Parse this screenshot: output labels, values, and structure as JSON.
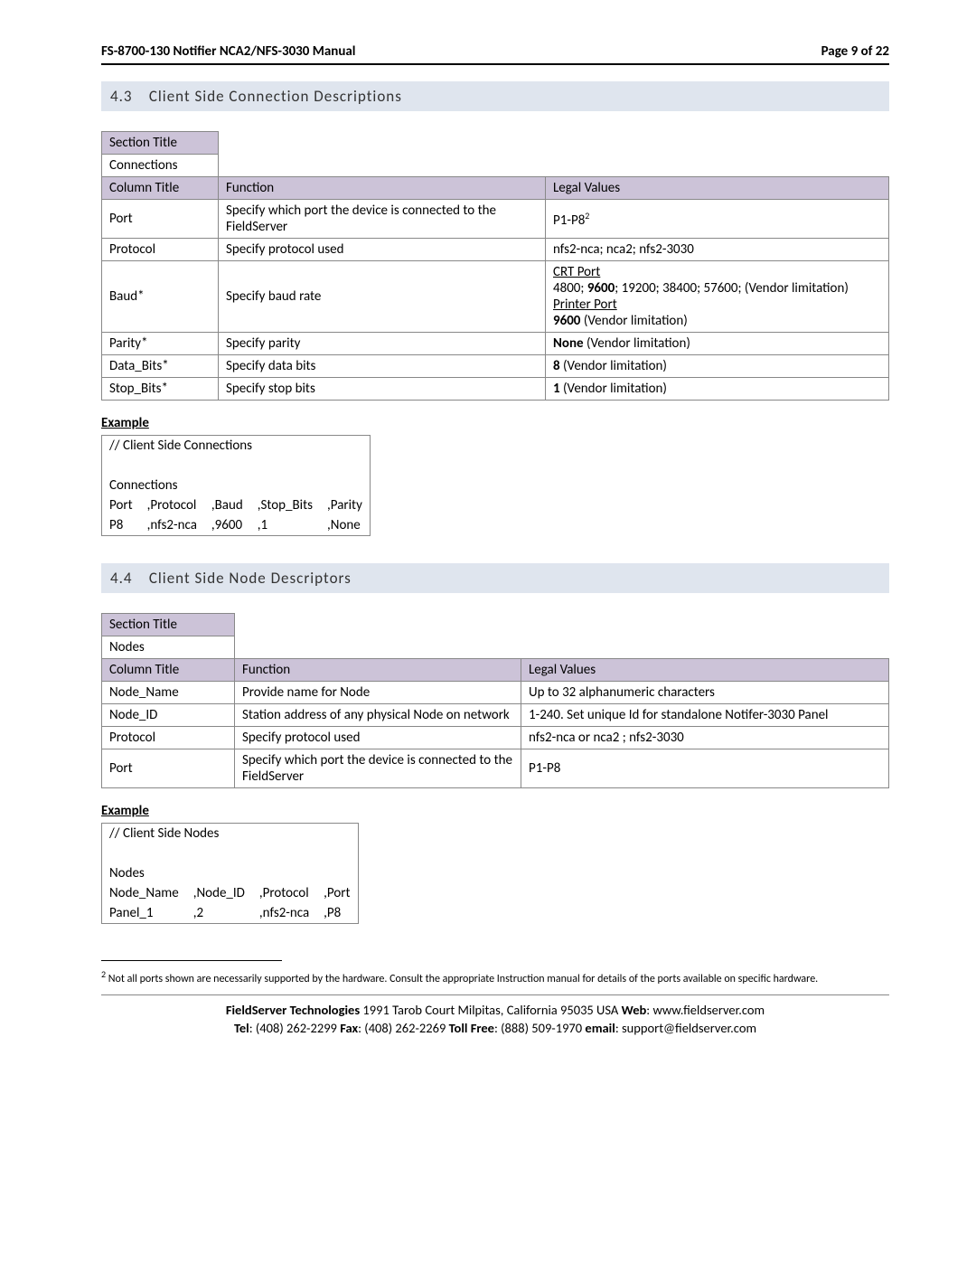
{
  "header": {
    "title": "FS-8700-130 Notifier NCA2/NFS-3030 Manual",
    "page": "Page 9 of 22"
  },
  "section43": {
    "num": "4.3",
    "title": "Client Side Connection Descriptions",
    "t_section_title": "Section Title",
    "t_connections": "Connections",
    "t_column_title": "Column Title",
    "t_function": "Function",
    "t_legal": "Legal Values",
    "rows": {
      "port": {
        "label": "Port",
        "func": "Specify which port the device is connected to the FieldServer",
        "legal_pre": "P1-P8",
        "legal_sup": "2"
      },
      "protocol": {
        "label": "Protocol",
        "func": "Specify protocol used",
        "legal": "nfs2-nca; nca2; nfs2-3030"
      },
      "baud": {
        "label": "Baud*",
        "func": "Specify baud rate",
        "crt": "CRT Port",
        "crt_vals_pre": "4800; ",
        "crt_vals_bold": "9600",
        "crt_vals_post": "; 19200; 38400; 57600; (Vendor limitation)",
        "prn": "Printer Port",
        "prn_bold": "9600",
        "prn_post": " (Vendor limitation)"
      },
      "parity": {
        "label": "Parity*",
        "func": "Specify parity",
        "legal_bold": "None",
        "legal_post": " (Vendor limitation)"
      },
      "databits": {
        "label": "Data_Bits*",
        "func": "Specify data bits",
        "legal_bold": "8",
        "legal_post": " (Vendor limitation)"
      },
      "stopbits": {
        "label": "Stop_Bits*",
        "func": "Specify stop bits",
        "legal_bold": "1",
        "legal_post": " (Vendor limitation)"
      }
    },
    "example_label": "Example",
    "code": {
      "l1": "//    Client Side Connections",
      "l2": "Connections",
      "h": {
        "c1": "Port",
        "c2": ",Protocol",
        "c3": ",Baud",
        "c4": ",Stop_Bits",
        "c5": ",Parity"
      },
      "d": {
        "c1": "P8",
        "c2": ",nfs2-nca",
        "c3": ",9600",
        "c4": ",1",
        "c5": ",None"
      }
    }
  },
  "section44": {
    "num": "4.4",
    "title": "Client Side Node Descriptors",
    "t_section_title": "Section Title",
    "t_nodes": "Nodes",
    "t_column_title": "Column Title",
    "t_function": "Function",
    "t_legal": "Legal Values",
    "rows": {
      "node_name": {
        "label": "Node_Name",
        "func": "Provide name for Node",
        "legal": "Up to 32 alphanumeric characters"
      },
      "node_id": {
        "label": "Node_ID",
        "func": "Station address of any physical Node on network",
        "legal": "1-240.  Set unique Id for standalone Notifer-3030 Panel"
      },
      "protocol": {
        "label": "Protocol",
        "func": "Specify protocol used",
        "legal": "nfs2-nca or nca2 ; nfs2-3030"
      },
      "port": {
        "label": "Port",
        "func": "Specify which port the device is connected to the FieldServer",
        "legal": "P1-P8"
      }
    },
    "example_label": "Example",
    "code": {
      "l1": "//    Client Side Nodes",
      "l2": "Nodes",
      "h": {
        "c1": "Node_Name",
        "c2": ",Node_ID",
        "c3": ",Protocol",
        "c4": ",Port"
      },
      "d": {
        "c1": "Panel_1",
        "c2": ",2",
        "c3": ",nfs2-nca",
        "c4": ",P8"
      }
    }
  },
  "footnote": {
    "num": "2",
    "text": " Not all ports shown are necessarily supported by the hardware. Consult the appropriate Instruction manual for details of the ports available on specific hardware."
  },
  "footer": {
    "l1a": "FieldServer Technologies",
    "l1b": " 1991 Tarob Court Milpitas, California 95035 USA   ",
    "l1c": "Web",
    "l1d": ": www.fieldserver.com",
    "l2a": "Tel",
    "l2b": ": (408) 262-2299   ",
    "l2c": "Fax",
    "l2d": ": (408) 262-2269   ",
    "l2e": "Toll Free",
    "l2f": ": (888) 509-1970   ",
    "l2g": "email",
    "l2h": ": support@fieldserver.com"
  }
}
